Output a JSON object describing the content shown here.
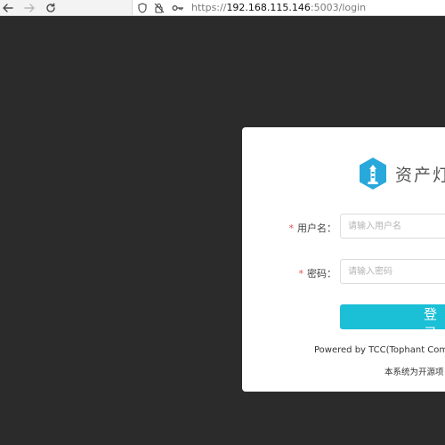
{
  "browser": {
    "url_scheme": "https://",
    "url_host": "192.168.115.146",
    "url_path": ":5003/login"
  },
  "login": {
    "brand_name": "资产灯",
    "username_label": "用户名",
    "username_placeholder": "请输入用户名",
    "password_label": "密码",
    "password_placeholder": "请输入密码",
    "required_mark": "*",
    "submit_label": "登录",
    "powered_by": "Powered by TCC(Tophant Compe",
    "notice": "本系统为开源项"
  },
  "colors": {
    "background": "#2b2b2b",
    "accent": "#1bbfd6",
    "logo": "#29a8dc",
    "required": "#e65050"
  }
}
